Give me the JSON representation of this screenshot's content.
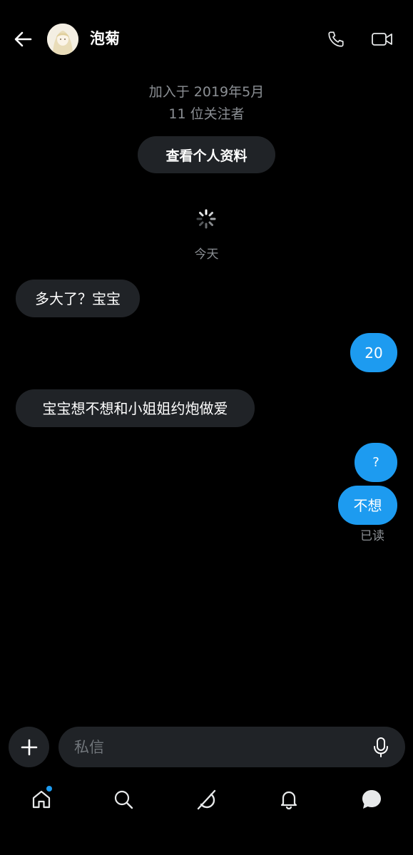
{
  "header": {
    "contact_name": "泡菊",
    "back_icon": "arrow-left-icon",
    "call_icon": "phone-icon",
    "video_icon": "video-camera-icon"
  },
  "profile": {
    "joined": "加入于 2019年5月",
    "followers": "11 位关注者",
    "view_profile_label": "查看个人资料"
  },
  "conversation": {
    "date_separator": "今天",
    "messages": [
      {
        "direction": "incoming",
        "text": "多大了？宝宝"
      },
      {
        "direction": "outgoing",
        "text": "20"
      },
      {
        "direction": "incoming",
        "text": "宝宝想不想和小姐姐约炮做爱"
      },
      {
        "direction": "outgoing",
        "text": "?"
      },
      {
        "direction": "outgoing",
        "text": "不想"
      }
    ],
    "read_receipt": "已读"
  },
  "composer": {
    "placeholder": "私信",
    "add_icon": "plus-icon",
    "mic_icon": "microphone-icon"
  },
  "bottom_nav": {
    "items": [
      {
        "icon": "home-icon",
        "has_notification_dot": true
      },
      {
        "icon": "search-icon"
      },
      {
        "icon": "grok-icon"
      },
      {
        "icon": "bell-icon"
      },
      {
        "icon": "messages-icon",
        "active": true
      }
    ]
  },
  "colors": {
    "background": "#000000",
    "incoming_bubble": "#202327",
    "outgoing_bubble": "#1d9bf0",
    "secondary_text": "#8b8f94"
  }
}
